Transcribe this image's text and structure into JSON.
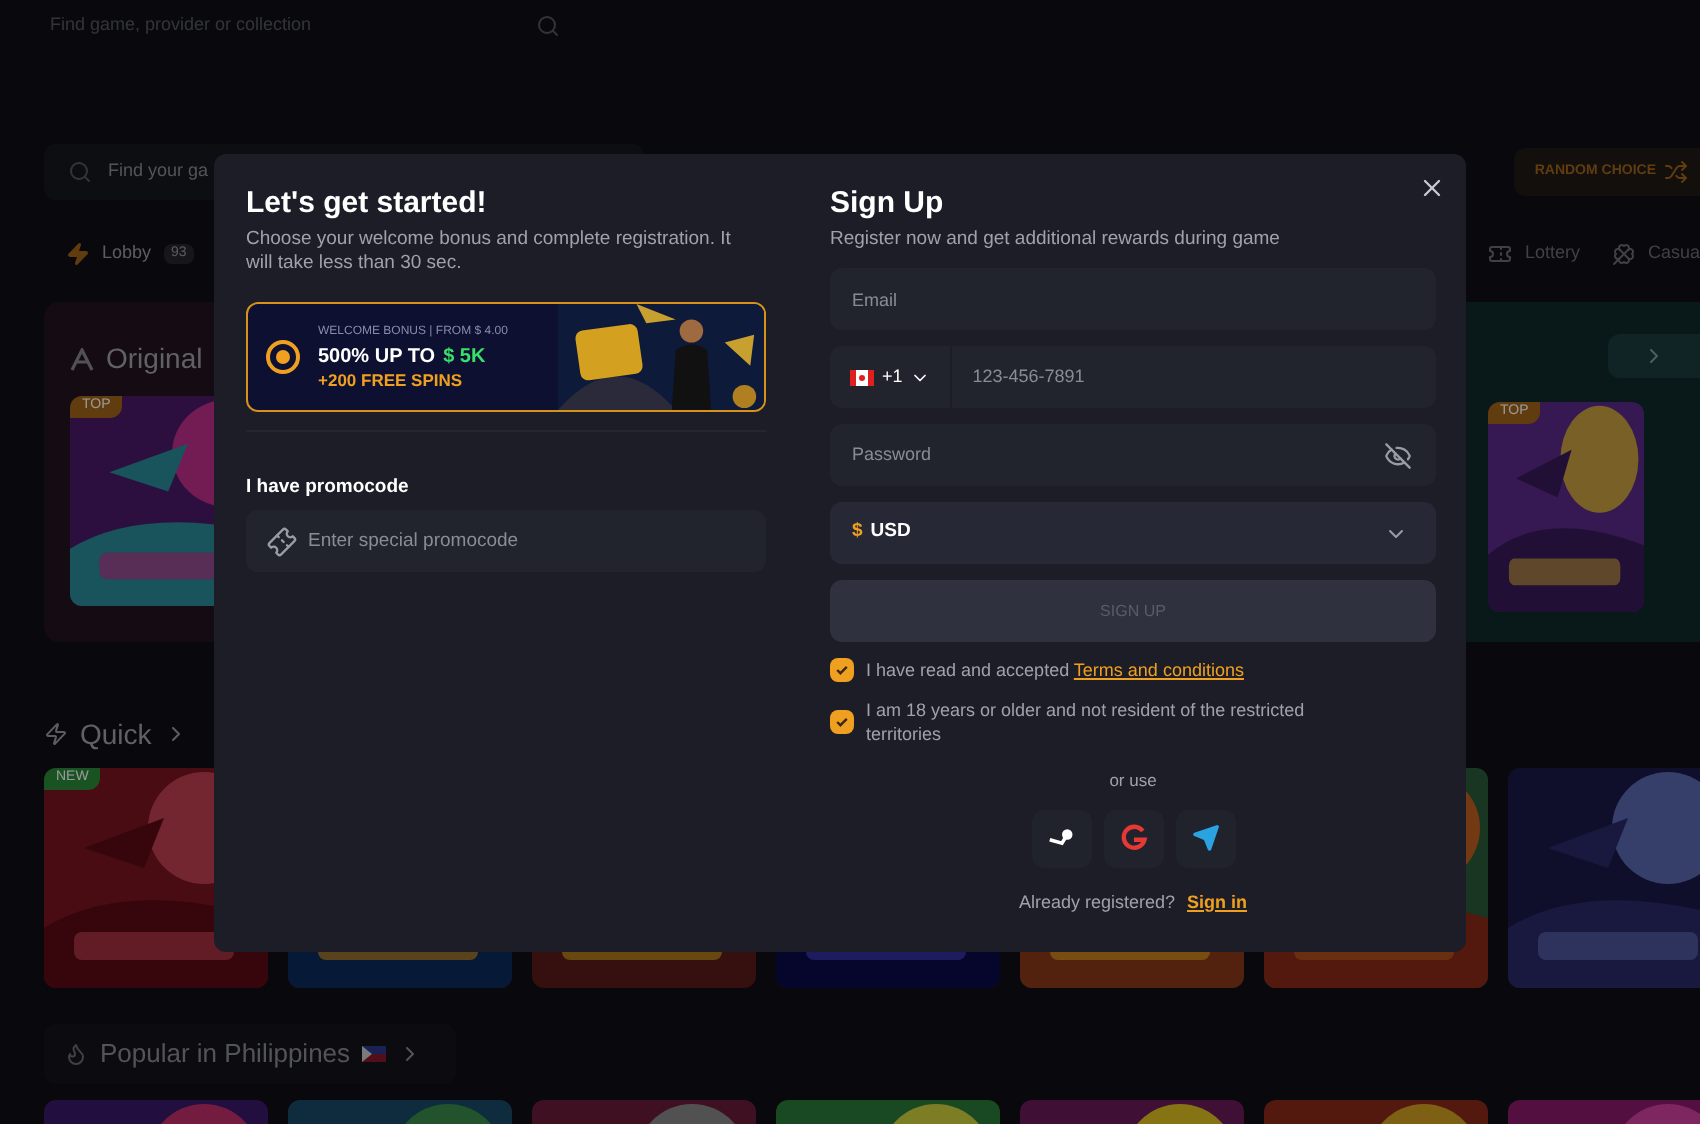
{
  "background": {
    "top_search": {
      "placeholder": "Find game, provider or collection"
    },
    "game_search": {
      "placeholder": "Find your ga"
    },
    "random_button": "RANDOM CHOICE",
    "tabs_left": [
      {
        "label": "Lobby",
        "count": "93"
      }
    ],
    "tabs_right": [
      {
        "label": "Lottery",
        "kind": "ticket"
      },
      {
        "label": "Casua",
        "kind": "clover"
      }
    ],
    "originals": {
      "title": "Original",
      "left_badge": "TOP",
      "right_badge": "TOP"
    },
    "quick": {
      "title": "Quick",
      "badge": "NEW"
    },
    "popular": {
      "title": "Popular in Philippines"
    }
  },
  "modal": {
    "title": "Let's get started!",
    "subtitle": "Choose your welcome bonus and complete registration. It will take less than 30 sec.",
    "bonus": {
      "selected": true,
      "caption": "WELCOME BONUS | FROM $ 4.00",
      "headline": "500% UP TO",
      "amount": "$ 5K",
      "spins": "+200 FREE SPINS"
    },
    "promo": {
      "label": "I have promocode",
      "placeholder": "Enter special promocode"
    },
    "signup": {
      "title": "Sign Up",
      "subtitle": "Register now and get additional rewards during game",
      "email": {
        "placeholder": "Email"
      },
      "phone": {
        "code": "+1",
        "placeholder": "123-456-7891"
      },
      "password": {
        "placeholder": "Password"
      },
      "currency": {
        "symbol": "$",
        "value": "USD"
      },
      "button": {
        "label": "SIGN UP",
        "disabled": true
      },
      "checks": [
        {
          "text": "I have read and accepted ",
          "link": "Terms and conditions",
          "checked": true
        },
        {
          "text": "I am 18 years or older and not resident of the restricted territories",
          "checked": true
        }
      ],
      "or_use": "or use",
      "socials": [
        {
          "kind": "steam"
        },
        {
          "kind": "google"
        },
        {
          "kind": "telegram"
        }
      ],
      "already": "Already registered?",
      "sign_in": "Sign in"
    }
  }
}
